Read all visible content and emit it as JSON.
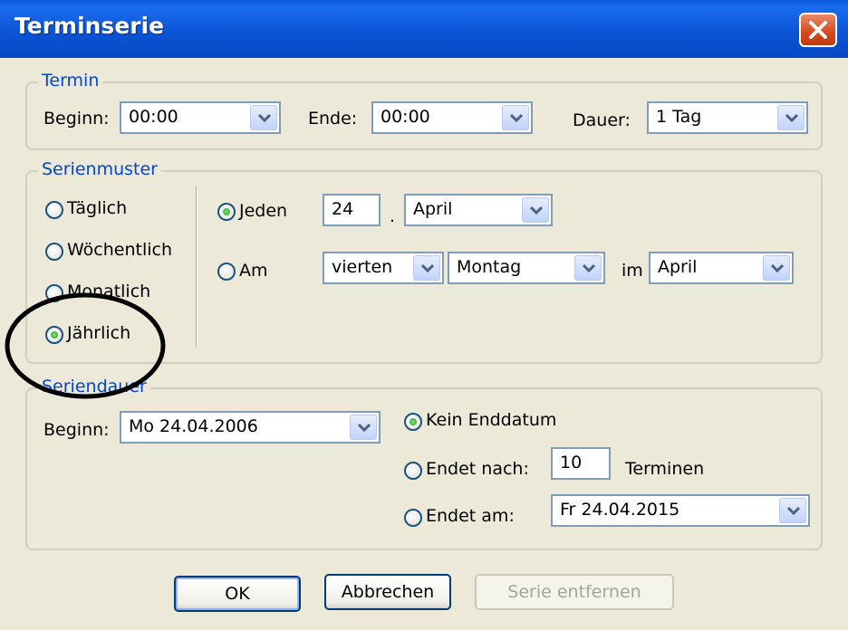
{
  "window": {
    "title": "Terminserie"
  },
  "termin": {
    "legend": "Termin",
    "beginn_label": "Beginn:",
    "beginn_value": "00:00",
    "ende_label": "Ende:",
    "ende_value": "00:00",
    "dauer_label": "Dauer:",
    "dauer_value": "1 Tag"
  },
  "serienmuster": {
    "legend": "Serienmuster",
    "options": [
      "Täglich",
      "Wöchentlich",
      "Monatlich",
      "Jährlich"
    ],
    "selected": "Jährlich",
    "jeden_label": "Jeden",
    "jeden_day": "24",
    "jeden_sep": ".",
    "jeden_month": "April",
    "am_label": "Am",
    "am_ordinal": "vierten",
    "am_weekday": "Montag",
    "im_label": "im",
    "am_month": "April",
    "selected_mode": "Jeden"
  },
  "seriendauer": {
    "legend": "Seriendauer",
    "beginn_label": "Beginn:",
    "beginn_value": "Mo 24.04.2006",
    "kein_enddatum_label": "Kein Enddatum",
    "endet_nach_label": "Endet nach:",
    "endet_nach_value": "10",
    "terminen_label": "Terminen",
    "endet_am_label": "Endet am:",
    "endet_am_value": "Fr 24.04.2015",
    "selected": "Kein Enddatum"
  },
  "buttons": {
    "ok": "OK",
    "abbrechen": "Abbrechen",
    "serie_entfernen": "Serie entfernen"
  },
  "colors": {
    "titlebar": "#0b55d6",
    "dialog_bg": "#ECE9D8",
    "legend_text": "#0046D5",
    "close_button": "#d2491e",
    "radio_dot": "#21a121"
  }
}
